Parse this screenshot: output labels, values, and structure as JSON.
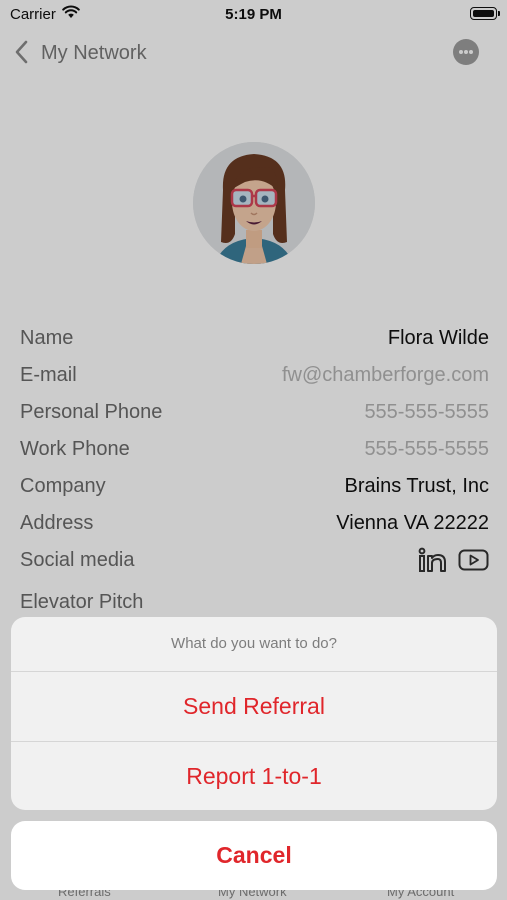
{
  "status_bar": {
    "carrier": "Carrier",
    "time": "5:19 PM"
  },
  "nav": {
    "back_label": "My Network"
  },
  "contact": {
    "fields": [
      {
        "label": "Name",
        "value": "Flora Wilde",
        "muted": false
      },
      {
        "label": "E-mail",
        "value": "fw@chamberforge.com",
        "muted": true
      },
      {
        "label": "Personal Phone",
        "value": "555-555-5555",
        "muted": true
      },
      {
        "label": "Work Phone",
        "value": "555-555-5555",
        "muted": true
      },
      {
        "label": "Company",
        "value": "Brains Trust, Inc",
        "muted": false
      },
      {
        "label": "Address",
        "value": "Vienna VA 22222",
        "muted": false
      }
    ],
    "social_label": "Social media",
    "social_icons": [
      "linkedin-icon",
      "youtube-icon"
    ],
    "pitch_label": "Elevator Pitch"
  },
  "tabs": [
    {
      "label": "Referrals"
    },
    {
      "label": "My Network"
    },
    {
      "label": "My Account"
    }
  ],
  "action_sheet": {
    "title": "What do you want to do?",
    "actions": [
      {
        "label": "Send Referral"
      },
      {
        "label": "Report 1-to-1"
      }
    ],
    "cancel_label": "Cancel"
  },
  "colors": {
    "destructive_red": "#e0262b",
    "label_gray": "#6b6b6b",
    "muted_value": "#b5b5b5"
  }
}
